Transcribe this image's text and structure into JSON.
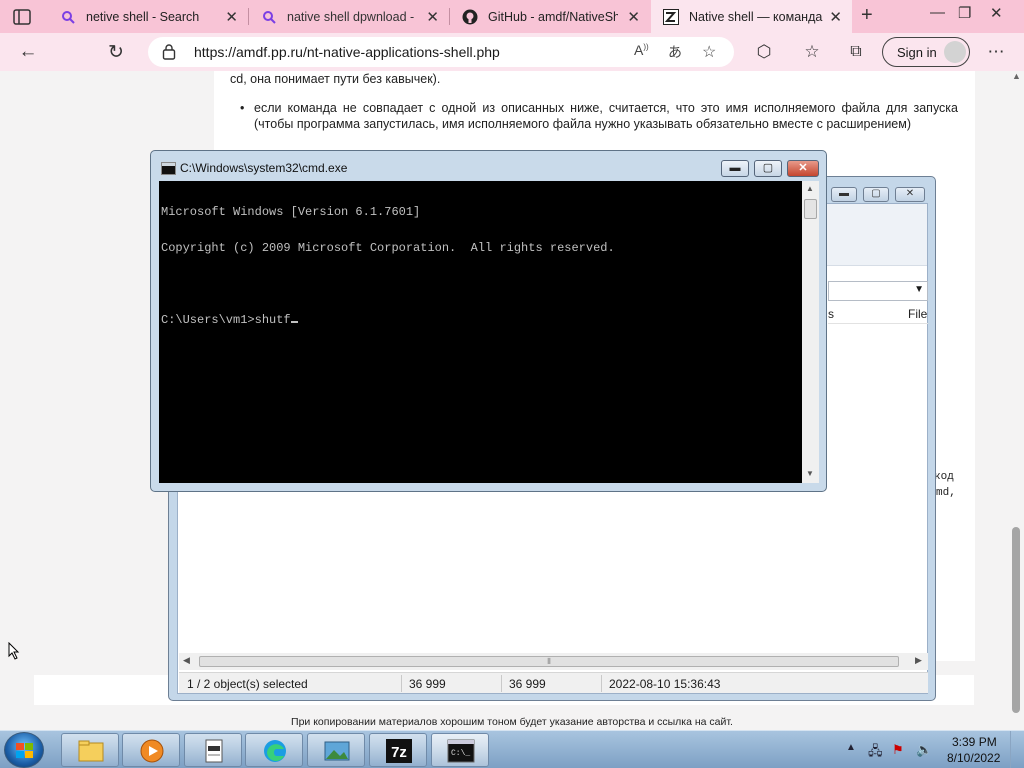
{
  "browser": {
    "tabs": [
      {
        "title": "netive shell - Search",
        "icon": "search-icon"
      },
      {
        "title": "native shell dpwnload - S",
        "icon": "search-icon"
      },
      {
        "title": "GitHub - amdf/NativeShe",
        "icon": "github-icon"
      },
      {
        "title": "Native shell — команда",
        "icon": "site-favicon",
        "active": true
      }
    ],
    "url": "https://amdf.pp.ru/nt-native-applications-shell.php",
    "signin_label": "Sign in"
  },
  "webpage": {
    "line_top": "cd, она понимает пути без кавычек).",
    "bullet": "если команда не совпадает с одной из описанных ниже, считается, что это имя исполняемого файла для запуска (чтобы программа запустилась, имя исполняемого файла нужно указывать обязательно вместе с расширением)",
    "code_fragment_1": "код",
    "code_fragment_2": "md,",
    "copyright": "При копировании материалов хорошим тоном будет указание авторства и ссылка на сайт."
  },
  "file_manager": {
    "col_partial_1": "s",
    "col_partial_2": "File",
    "status": {
      "selection": "1 / 2 object(s) selected",
      "size": "36 999",
      "packed": "36 999",
      "modified": "2022-08-10 15:36:43"
    }
  },
  "cmd": {
    "title": "C:\\Windows\\system32\\cmd.exe",
    "lines": [
      "Microsoft Windows [Version 6.1.7601]",
      "Copyright (c) 2009 Microsoft Corporation.  All rights reserved.",
      "",
      "C:\\Users\\vm1>shutf"
    ]
  },
  "taskbar": {
    "apps": [
      {
        "name": "explorer",
        "icon": "folder-icon"
      },
      {
        "name": "media-player",
        "icon": "media-player-icon"
      },
      {
        "name": "notepad",
        "icon": "notepad-icon"
      },
      {
        "name": "edge",
        "icon": "edge-icon"
      },
      {
        "name": "image-viewer",
        "icon": "picture-icon"
      },
      {
        "name": "7zip",
        "icon": "7zip-icon",
        "label": "7z"
      },
      {
        "name": "cmd",
        "icon": "cmd-icon",
        "label": "C:\\_"
      }
    ],
    "time": "3:39 PM",
    "date": "8/10/2022"
  }
}
